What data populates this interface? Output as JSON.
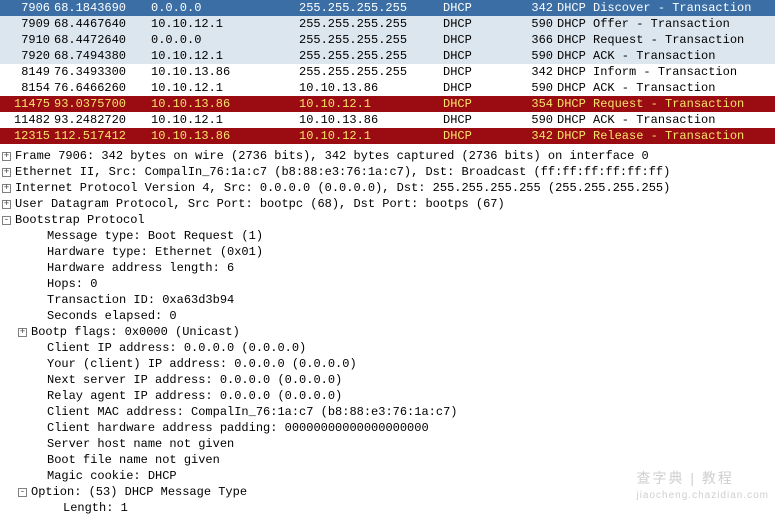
{
  "packets": [
    {
      "no": "7906",
      "time": "68.1843690",
      "src": "0.0.0.0",
      "dst": "255.255.255.255",
      "proto": "DHCP",
      "len": "342",
      "info": "DHCP Discover - Transaction",
      "cls": "selected"
    },
    {
      "no": "7909",
      "time": "68.4467640",
      "src": "10.10.12.1",
      "dst": "255.255.255.255",
      "proto": "DHCP",
      "len": "590",
      "info": "DHCP Offer    - Transaction",
      "cls": "light"
    },
    {
      "no": "7910",
      "time": "68.4472640",
      "src": "0.0.0.0",
      "dst": "255.255.255.255",
      "proto": "DHCP",
      "len": "366",
      "info": "DHCP Request  - Transaction",
      "cls": "light"
    },
    {
      "no": "7920",
      "time": "68.7494380",
      "src": "10.10.12.1",
      "dst": "255.255.255.255",
      "proto": "DHCP",
      "len": "590",
      "info": "DHCP ACK      - Transaction",
      "cls": "light"
    },
    {
      "no": "8149",
      "time": "76.3493300",
      "src": "10.10.13.86",
      "dst": "255.255.255.255",
      "proto": "DHCP",
      "len": "342",
      "info": "DHCP Inform   - Transaction",
      "cls": "white"
    },
    {
      "no": "8154",
      "time": "76.6466260",
      "src": "10.10.12.1",
      "dst": "10.10.13.86",
      "proto": "DHCP",
      "len": "590",
      "info": "DHCP ACK      - Transaction",
      "cls": "white"
    },
    {
      "no": "11475",
      "time": "93.0375700",
      "src": "10.10.13.86",
      "dst": "10.10.12.1",
      "proto": "DHCP",
      "len": "354",
      "info": "DHCP Request  - Transaction",
      "cls": "dark"
    },
    {
      "no": "11482",
      "time": "93.2482720",
      "src": "10.10.12.1",
      "dst": "10.10.13.86",
      "proto": "DHCP",
      "len": "590",
      "info": "DHCP ACK      - Transaction",
      "cls": "white"
    },
    {
      "no": "12315",
      "time": "112.517412",
      "src": "10.10.13.86",
      "dst": "10.10.12.1",
      "proto": "DHCP",
      "len": "342",
      "info": "DHCP Release  - Transaction",
      "cls": "dark"
    }
  ],
  "details": [
    {
      "ind": 0,
      "sym": "+",
      "text": "Frame 7906: 342 bytes on wire (2736 bits), 342 bytes captured (2736 bits) on interface 0"
    },
    {
      "ind": 0,
      "sym": "+",
      "text": "Ethernet II, Src: CompalIn_76:1a:c7 (b8:88:e3:76:1a:c7), Dst: Broadcast (ff:ff:ff:ff:ff:ff)"
    },
    {
      "ind": 0,
      "sym": "+",
      "text": "Internet Protocol Version 4, Src: 0.0.0.0 (0.0.0.0), Dst: 255.255.255.255 (255.255.255.255)"
    },
    {
      "ind": 0,
      "sym": "+",
      "text": "User Datagram Protocol, Src Port: bootpc (68), Dst Port: bootps (67)"
    },
    {
      "ind": 0,
      "sym": "-",
      "text": "Bootstrap Protocol"
    },
    {
      "ind": 2,
      "sym": "",
      "text": "Message type: Boot Request (1)"
    },
    {
      "ind": 2,
      "sym": "",
      "text": "Hardware type: Ethernet (0x01)"
    },
    {
      "ind": 2,
      "sym": "",
      "text": "Hardware address length: 6"
    },
    {
      "ind": 2,
      "sym": "",
      "text": "Hops: 0"
    },
    {
      "ind": 2,
      "sym": "",
      "text": "Transaction ID: 0xa63d3b94"
    },
    {
      "ind": 2,
      "sym": "",
      "text": "Seconds elapsed: 0"
    },
    {
      "ind": 1,
      "sym": "+",
      "text": "Bootp flags: 0x0000 (Unicast)"
    },
    {
      "ind": 2,
      "sym": "",
      "text": "Client IP address: 0.0.0.0 (0.0.0.0)"
    },
    {
      "ind": 2,
      "sym": "",
      "text": "Your (client) IP address: 0.0.0.0 (0.0.0.0)"
    },
    {
      "ind": 2,
      "sym": "",
      "text": "Next server IP address: 0.0.0.0 (0.0.0.0)"
    },
    {
      "ind": 2,
      "sym": "",
      "text": "Relay agent IP address: 0.0.0.0 (0.0.0.0)"
    },
    {
      "ind": 2,
      "sym": "",
      "text": "Client MAC address: CompalIn_76:1a:c7 (b8:88:e3:76:1a:c7)"
    },
    {
      "ind": 2,
      "sym": "",
      "text": "Client hardware address padding: 00000000000000000000"
    },
    {
      "ind": 2,
      "sym": "",
      "text": "Server host name not given"
    },
    {
      "ind": 2,
      "sym": "",
      "text": "Boot file name not given"
    },
    {
      "ind": 2,
      "sym": "",
      "text": "Magic cookie: DHCP"
    },
    {
      "ind": 1,
      "sym": "-",
      "text": "Option: (53) DHCP Message Type"
    },
    {
      "ind": 3,
      "sym": "",
      "text": "Length: 1"
    }
  ],
  "watermark": {
    "line1": "查字典 | 教程",
    "line2": "jiaocheng.chazidian.com"
  }
}
